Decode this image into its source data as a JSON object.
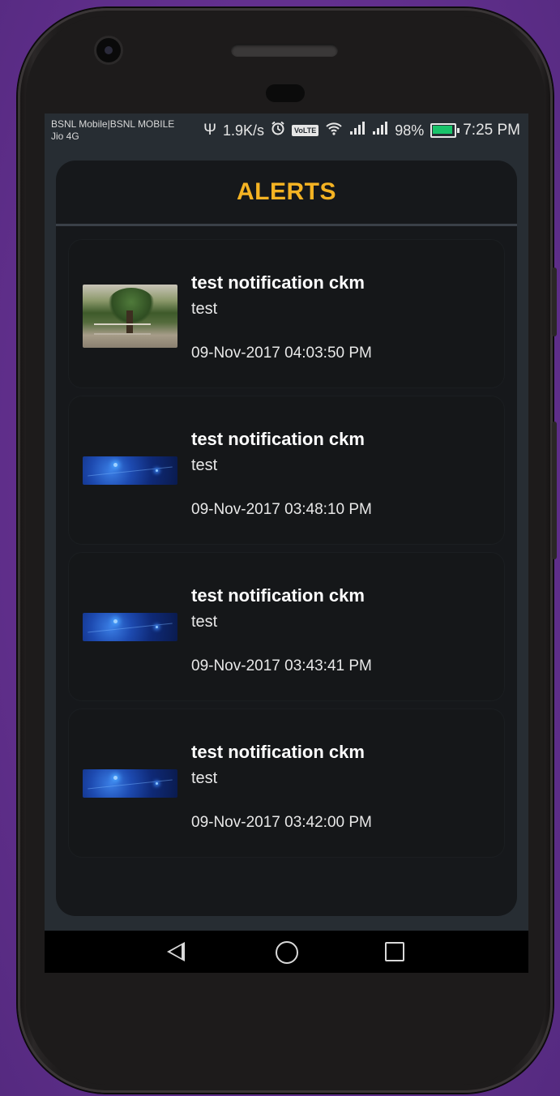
{
  "status_bar": {
    "carrier_line1": "BSNL Mobile|BSNL MOBILE",
    "carrier_line2": "Jio 4G",
    "usb_icon": "usb-icon",
    "net_speed": "1.9K/s",
    "alarm_icon": "alarm-icon",
    "volte": "VoLTE",
    "wifi_icon": "wifi-icon",
    "signal_icon": "signal-icon",
    "battery": "98%",
    "time": "7:25 PM"
  },
  "header": {
    "title": "ALERTS",
    "title_color": "#f5b323"
  },
  "notifications": [
    {
      "title": "test notification ckm",
      "body": "test",
      "time": "09-Nov-2017 04:03:50 PM",
      "thumbnail": "photo"
    },
    {
      "title": "test notification ckm",
      "body": "test",
      "time": "09-Nov-2017 03:48:10 PM",
      "thumbnail": "blue-tech"
    },
    {
      "title": "test notification ckm",
      "body": "test",
      "time": "09-Nov-2017 03:43:41 PM",
      "thumbnail": "blue-tech"
    },
    {
      "title": "test notification ckm",
      "body": "test",
      "time": "09-Nov-2017 03:42:00 PM",
      "thumbnail": "blue-tech"
    }
  ],
  "navbar": {
    "back_icon": "back-triangle-icon",
    "home_icon": "home-circle-icon",
    "recent_icon": "recents-square-icon"
  },
  "colors": {
    "background": "#672f96",
    "screen": "#272d33",
    "panel": "#16181b",
    "accent": "#f5b323"
  }
}
